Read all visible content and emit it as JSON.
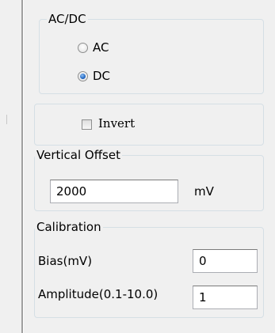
{
  "acdc": {
    "title": "AC/DC",
    "options": [
      {
        "label": "AC",
        "selected": false
      },
      {
        "label": "DC",
        "selected": true
      }
    ]
  },
  "invert": {
    "label": "Invert",
    "checked": false
  },
  "vertical_offset": {
    "title": "Vertical Offset",
    "value": "2000",
    "unit": "mV"
  },
  "calibration": {
    "title": "Calibration",
    "bias_label": "Bias(mV)",
    "bias_value": "0",
    "amplitude_label": "Amplitude(0.1-10.0)",
    "amplitude_value": "1"
  }
}
